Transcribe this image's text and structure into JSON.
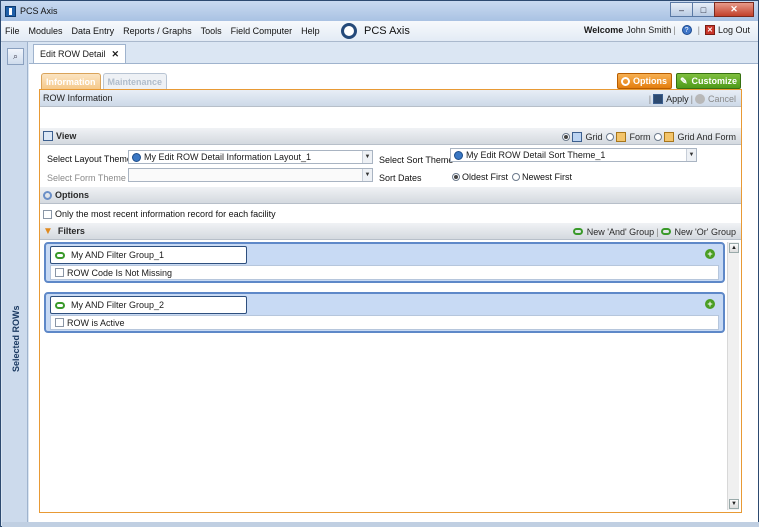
{
  "window": {
    "title": "PCS Axis",
    "minimize": "–",
    "maximize": "□",
    "close": "✕"
  },
  "menu": [
    "File",
    "Modules",
    "Data Entry",
    "Reports / Graphs",
    "Tools",
    "Field Computer",
    "Help"
  ],
  "brand": {
    "name": "PCS Axis"
  },
  "user": {
    "welcome": "Welcome",
    "name": "John Smith",
    "logout": "Log Out"
  },
  "sidebar": {
    "label": "Selected ROWs"
  },
  "tab": {
    "label": "Edit ROW Detail"
  },
  "inner_tabs": [
    "Information",
    "Maintenance"
  ],
  "buttons": {
    "options": "Options",
    "customize": "Customize"
  },
  "row_info": {
    "title": "ROW Information",
    "apply": "Apply",
    "cancel": "Cancel"
  },
  "view": {
    "title": "View",
    "grid": "Grid",
    "form": "Form",
    "grid_and_form": "Grid And Form",
    "selected_view": "Grid",
    "layout_label": "Select Layout Theme",
    "layout_value": "My Edit ROW Detail Information Layout_1",
    "form_label": "Select Form Theme",
    "form_value": "",
    "sort_label": "Select Sort Theme",
    "sort_value": "My Edit ROW Detail Sort Theme_1",
    "sort_dates_label": "Sort Dates",
    "oldest": "Oldest First",
    "newest": "Newest First",
    "selected_sort": "Oldest First"
  },
  "options": {
    "title": "Options",
    "recent_only": "Only the most recent information record for each facility"
  },
  "filters": {
    "title": "Filters",
    "new_and": "New 'And' Group",
    "new_or": "New 'Or' Group",
    "groups": [
      {
        "name": "My AND Filter Group_1",
        "criterion": "ROW Code Is Not Missing"
      },
      {
        "name": "My AND Filter Group_2",
        "criterion": "ROW is Active"
      }
    ]
  },
  "colors": {
    "accent_orange": "#e89a35",
    "header_blue": "#c8daf4",
    "customize_green": "#4e9a1a"
  }
}
